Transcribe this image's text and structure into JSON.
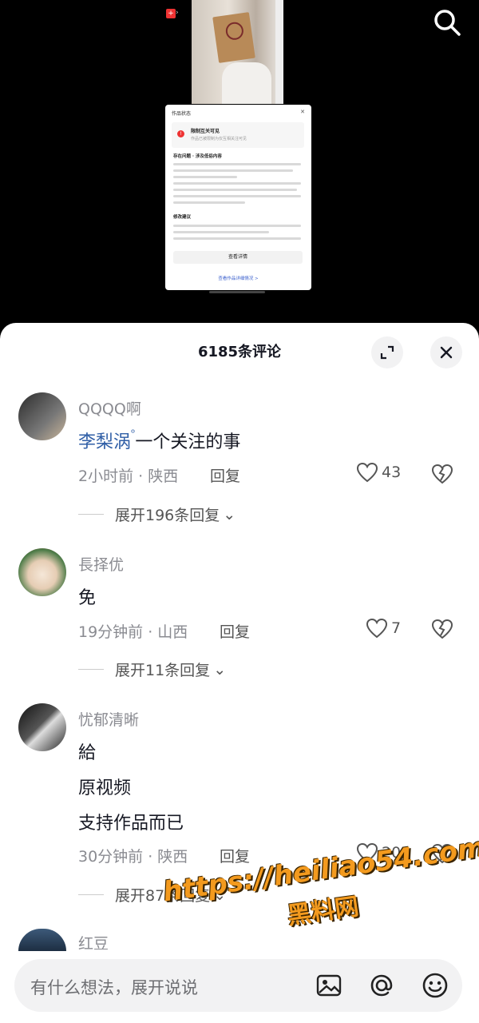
{
  "video": {
    "notice": {
      "title": "作品状态",
      "alert_title": "限制互关可见",
      "alert_sub": "作品已被限制为仅互相关注可见",
      "section1": "存在问题 · 涉及低俗内容",
      "section2": "修改建议",
      "button": "查看详情",
      "link": "查看作品详细情况 >"
    }
  },
  "comments_header": {
    "title": "6185条评论"
  },
  "comments": [
    {
      "username": "QQQQ啊",
      "mention": "李梨涡",
      "text": "一个关注的事",
      "meta": "2小时前 · 陕西",
      "reply": "回复",
      "likes": "43",
      "expand": "展开196条回复"
    },
    {
      "username": "長择优",
      "text": "免",
      "meta": "19分钟前 · 山西",
      "reply": "回复",
      "likes": "7",
      "expand": "展开11条回复"
    },
    {
      "username": "忧郁清晰",
      "lines": [
        "給",
        "原视频",
        "支持作品而已"
      ],
      "meta": "30分钟前 · 陕西",
      "reply": "回复",
      "likes": "20",
      "expand": "展开87条回复"
    },
    {
      "username": "红豆"
    }
  ],
  "watermark": {
    "url": "https://heiliao54.com",
    "name": "黑料网"
  },
  "input": {
    "placeholder": "有什么想法，展开说说"
  },
  "icons": {
    "search": "search-icon",
    "expand": "expand-icon",
    "close": "close-icon",
    "heart": "heart-icon",
    "dislike": "dislike-heart-icon",
    "image": "image-icon",
    "at": "at-icon",
    "emoji": "emoji-icon"
  },
  "colors": {
    "mention": "#2f5ea6",
    "watermark": "#f39a1e",
    "meta": "#8a8b91"
  }
}
